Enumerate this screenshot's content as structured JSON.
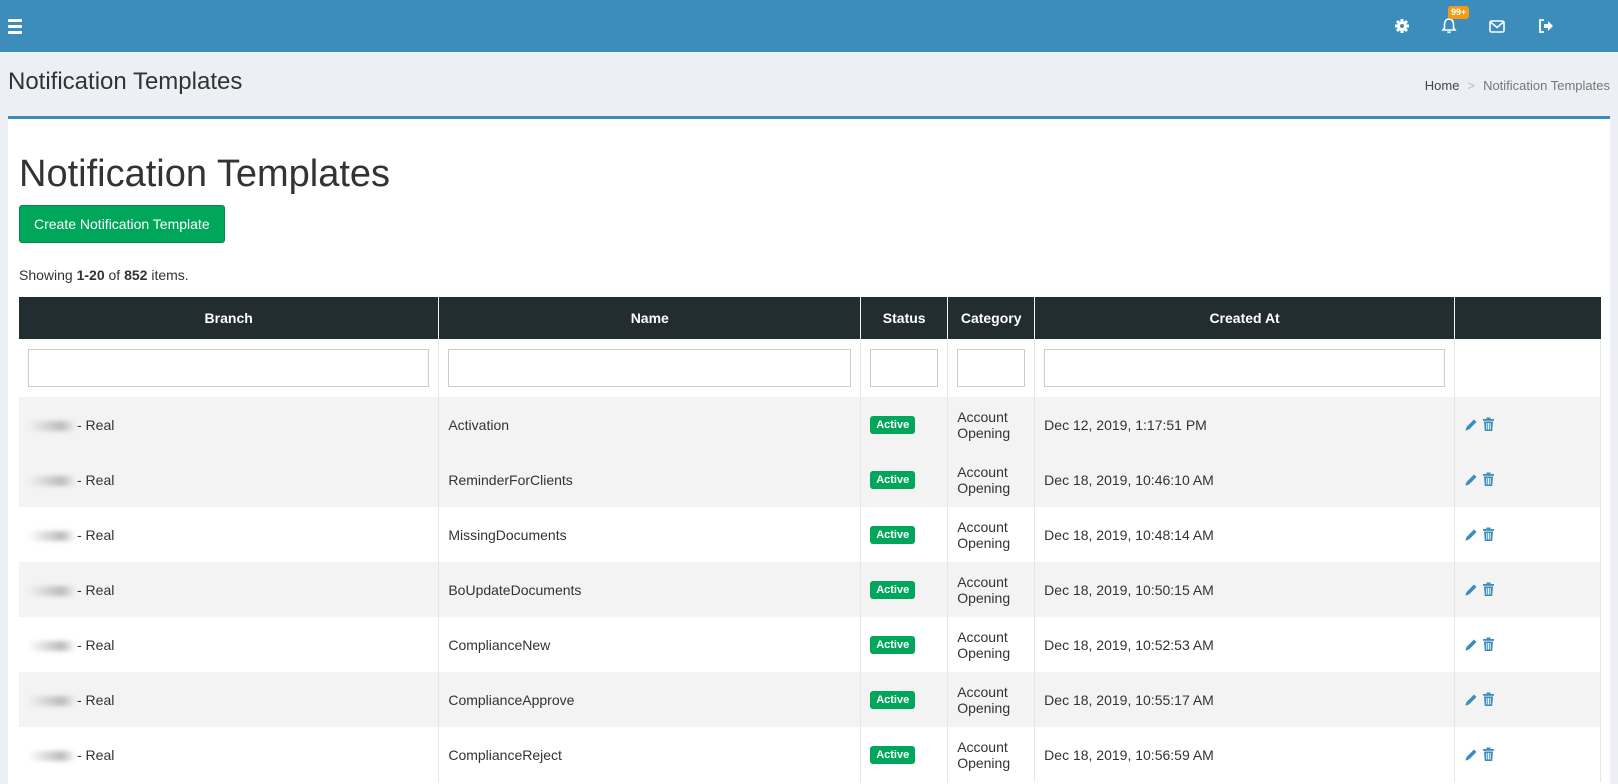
{
  "topbar": {
    "notification_count": "99+",
    "icons": [
      "menu-icon",
      "gear-icon",
      "bell-icon",
      "envelope-icon",
      "sign-out-icon"
    ],
    "color": "#3c8dbc"
  },
  "header": {
    "title": "Notification Templates",
    "breadcrumb": {
      "home": "Home",
      "separator": ">",
      "current": "Notification Templates"
    }
  },
  "main": {
    "title": "Notification Templates",
    "create_button": "Create Notification Template",
    "summary": {
      "prefix": "Showing ",
      "range": "1-20",
      "of": " of ",
      "total": "852",
      "suffix": " items."
    }
  },
  "table": {
    "columns": [
      "Branch",
      "Name",
      "Status",
      "Category",
      "Created At",
      ""
    ],
    "rows": [
      {
        "branch": "- Real",
        "name": "Activation",
        "status": "Active",
        "category": "Account Opening",
        "created_at": "Dec 12, 2019, 1:17:51 PM"
      },
      {
        "branch": "- Real",
        "name": "ReminderForClients",
        "status": "Active",
        "category": "Account Opening",
        "created_at": "Dec 18, 2019, 10:46:10 AM"
      },
      {
        "branch": "- Real",
        "name": "MissingDocuments",
        "status": "Active",
        "category": "Account Opening",
        "created_at": "Dec 18, 2019, 10:48:14 AM"
      },
      {
        "branch": "- Real",
        "name": "BoUpdateDocuments",
        "status": "Active",
        "category": "Account Opening",
        "created_at": "Dec 18, 2019, 10:50:15 AM"
      },
      {
        "branch": "- Real",
        "name": "ComplianceNew",
        "status": "Active",
        "category": "Account Opening",
        "created_at": "Dec 18, 2019, 10:52:53 AM"
      },
      {
        "branch": "- Real",
        "name": "ComplianceApprove",
        "status": "Active",
        "category": "Account Opening",
        "created_at": "Dec 18, 2019, 10:55:17 AM"
      },
      {
        "branch": "- Real",
        "name": "ComplianceReject",
        "status": "Active",
        "category": "Account Opening",
        "created_at": "Dec 18, 2019, 10:56:59 AM"
      }
    ],
    "header_color": "#222d32",
    "status_color": "#00a65a",
    "action_color": "#3c8dbc"
  }
}
